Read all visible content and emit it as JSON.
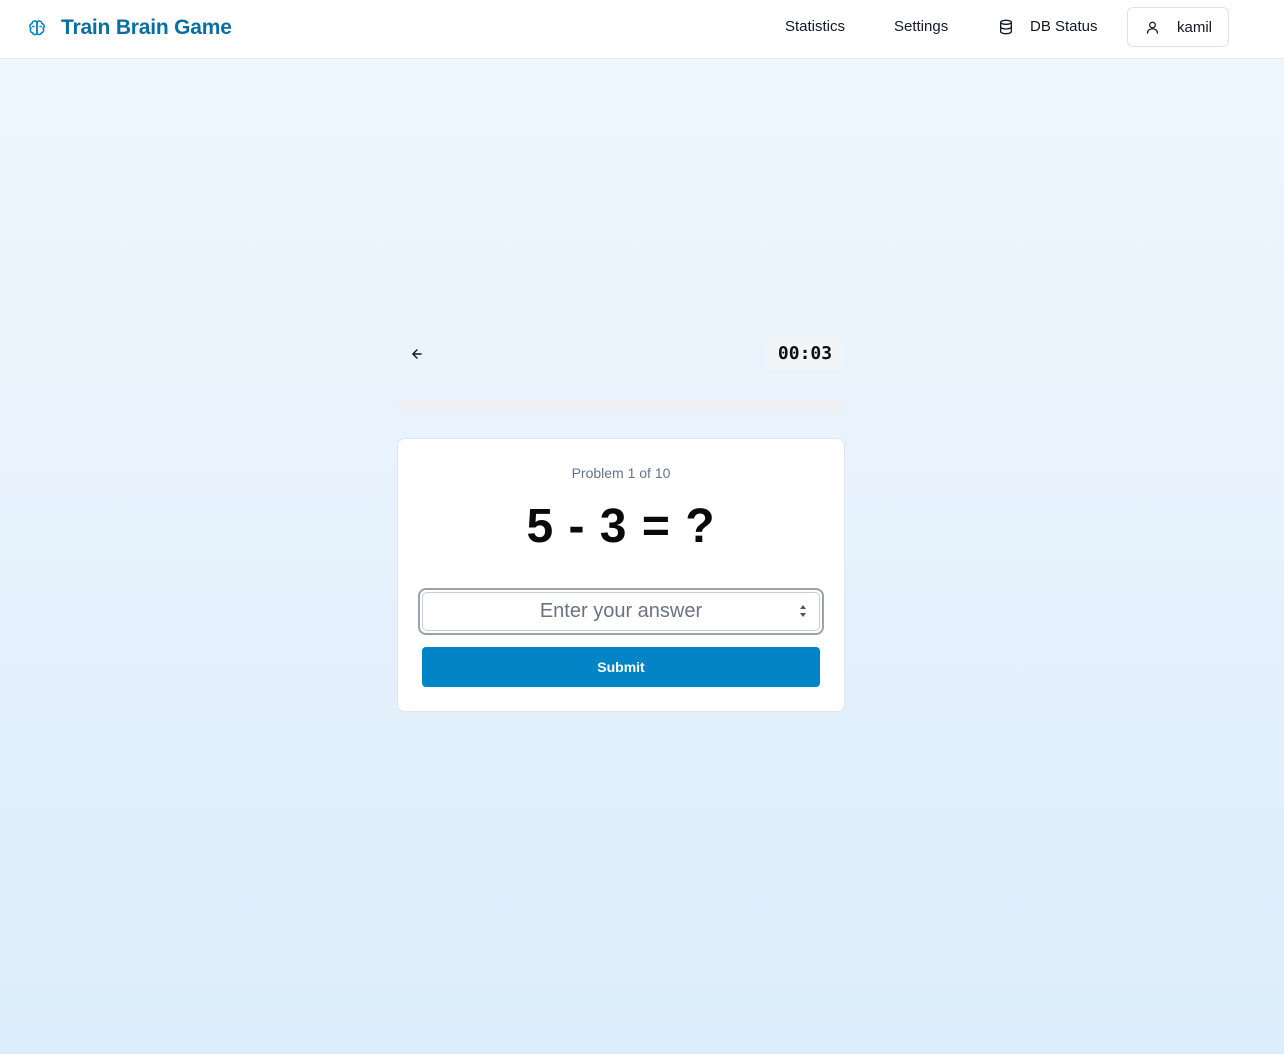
{
  "header": {
    "title": "Train Brain Game",
    "brand_icon": "brain-icon",
    "nav": {
      "statistics": "Statistics",
      "settings": "Settings",
      "db_status": "DB Status",
      "db_icon": "database-icon"
    },
    "user": {
      "name": "kamil",
      "icon": "user-icon"
    }
  },
  "game": {
    "back_icon": "arrow-left-icon",
    "timer": "00:03",
    "progress_fraction": 0,
    "problem_counter": "Problem 1 of 10",
    "problem": "5 - 3 = ?",
    "answer": {
      "value": "",
      "placeholder": "Enter your answer"
    },
    "submit_label": "Submit"
  },
  "colors": {
    "brand": "#0b6ea3",
    "accent": "#0284c7",
    "background_top": "#f0f7fe",
    "background_bottom": "#dcedfb"
  }
}
